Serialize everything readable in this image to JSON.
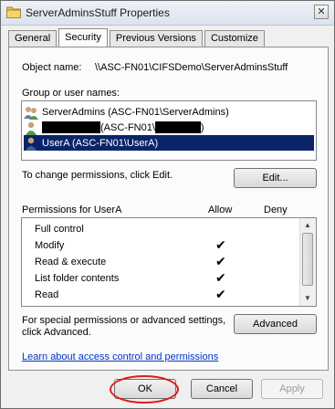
{
  "window": {
    "title": "ServerAdminsStuff Properties",
    "close_glyph": "✕"
  },
  "tabs": [
    "General",
    "Security",
    "Previous Versions",
    "Customize"
  ],
  "object": {
    "label": "Object name:",
    "value": "\\\\ASC-FN01\\CIFSDemo\\ServerAdminsStuff"
  },
  "groups": {
    "label": "Group or user names:",
    "items": [
      {
        "text": "ServerAdmins (ASC-FN01\\ServerAdmins)",
        "icon": "group-icon"
      },
      {
        "text_before": "",
        "text_mid": "(ASC-FN01\\",
        "text_after": ")",
        "icon": "user-icon",
        "redacted": true
      },
      {
        "text": "UserA (ASC-FN01\\UserA)",
        "icon": "user-icon",
        "selected": true
      }
    ]
  },
  "change_hint": "To change permissions, click Edit.",
  "edit_button": "Edit...",
  "permissions": {
    "label": "Permissions for UserA",
    "allow_header": "Allow",
    "deny_header": "Deny",
    "rows": [
      {
        "name": "Full control",
        "allow": "",
        "deny": ""
      },
      {
        "name": "Modify",
        "allow": "✔",
        "deny": ""
      },
      {
        "name": "Read & execute",
        "allow": "✔",
        "deny": ""
      },
      {
        "name": "List folder contents",
        "allow": "✔",
        "deny": ""
      },
      {
        "name": "Read",
        "allow": "✔",
        "deny": ""
      }
    ]
  },
  "special_hint_line1": "For special permissions or advanced settings,",
  "special_hint_line2": "click Advanced.",
  "advanced_button": "Advanced",
  "learn_link": "Learn about access control and permissions",
  "footer": {
    "ok": "OK",
    "cancel": "Cancel",
    "apply": "Apply"
  },
  "colors": {
    "selection": "#0a246a",
    "link": "#0033cc",
    "highlight_circle": "#e01a1a"
  }
}
